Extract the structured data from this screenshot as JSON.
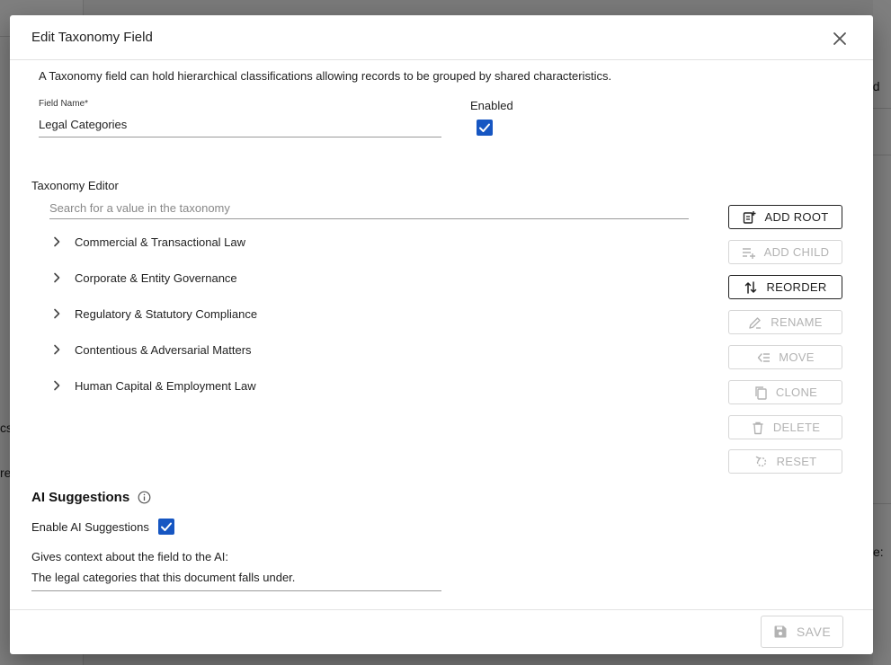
{
  "background": {
    "fragments": [
      "ed",
      "cs",
      "re",
      "e:"
    ]
  },
  "dialog": {
    "title": "Edit Taxonomy Field",
    "close_icon": "close-icon",
    "description": "A Taxonomy field can hold hierarchical classifications allowing records to be grouped by shared characteristics."
  },
  "field_name": {
    "label": "Field Name*",
    "value": "Legal Categories"
  },
  "enabled": {
    "label": "Enabled",
    "checked": true
  },
  "taxonomy_editor": {
    "label": "Taxonomy Editor",
    "search_placeholder": "Search for a value in the taxonomy",
    "items": [
      {
        "label": "Commercial & Transactional Law"
      },
      {
        "label": "Corporate & Entity Governance"
      },
      {
        "label": "Regulatory & Statutory Compliance"
      },
      {
        "label": "Contentious & Adversarial Matters"
      },
      {
        "label": "Human Capital & Employment Law"
      }
    ],
    "actions": [
      {
        "label": "ADD ROOT",
        "icon": "add-root-icon",
        "enabled": true
      },
      {
        "label": "ADD CHILD",
        "icon": "add-child-icon",
        "enabled": false
      },
      {
        "label": "REORDER",
        "icon": "reorder-icon",
        "enabled": true
      },
      {
        "label": "RENAME",
        "icon": "rename-icon",
        "enabled": false
      },
      {
        "label": "MOVE",
        "icon": "move-icon",
        "enabled": false
      },
      {
        "label": "CLONE",
        "icon": "clone-icon",
        "enabled": false
      },
      {
        "label": "DELETE",
        "icon": "delete-icon",
        "enabled": false
      },
      {
        "label": "RESET",
        "icon": "reset-icon",
        "enabled": false
      }
    ]
  },
  "ai_suggestions": {
    "title": "AI Suggestions",
    "info_icon": "info-icon",
    "enable_label": "Enable AI Suggestions",
    "enabled": true,
    "context_label": "Gives context about the field to the AI:",
    "context_value": "The legal categories that this document falls under."
  },
  "footer": {
    "save_label": "SAVE",
    "save_icon": "save-icon",
    "save_enabled": false
  },
  "colors": {
    "accent": "#1656c2",
    "disabled_text": "#b3b3b3",
    "overlay": "rgba(0,0,0,0.5)"
  }
}
